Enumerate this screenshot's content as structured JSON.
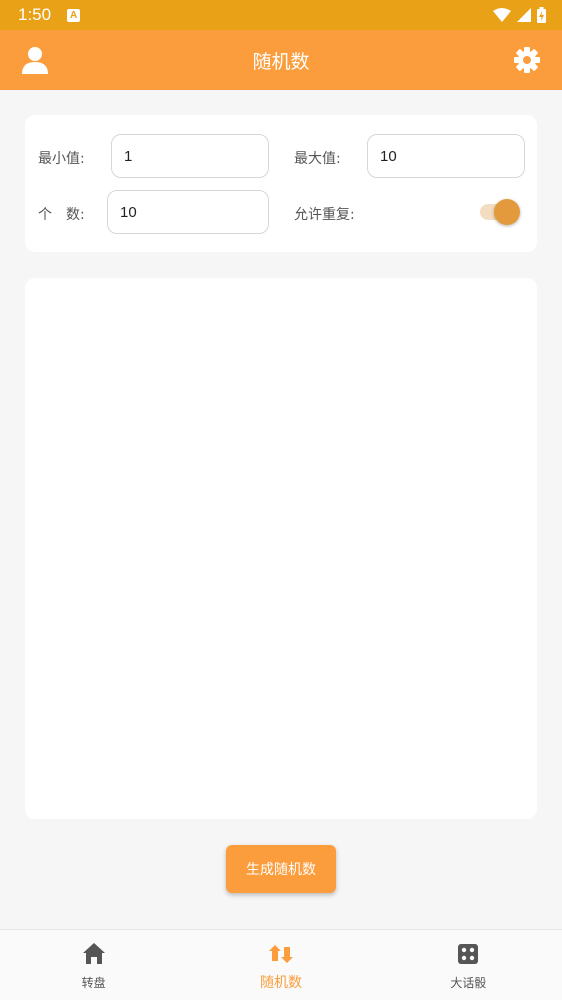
{
  "status_bar": {
    "time": "1:50",
    "notification_badge": "A"
  },
  "app_bar": {
    "title": "随机数",
    "left_icon": "user-icon",
    "right_icon": "gear-icon"
  },
  "settings": {
    "min_label": "最小值:",
    "min_value": "1",
    "max_label": "最大值:",
    "max_value": "10",
    "count_label": "个　数:",
    "count_value": "10",
    "repeat_label": "允许重复:",
    "repeat_enabled": true
  },
  "output": {
    "results": []
  },
  "generate_button": {
    "label": "生成随机数"
  },
  "bottom_nav": {
    "items": [
      {
        "label": "转盘",
        "icon": "home-icon",
        "active": false
      },
      {
        "label": "随机数",
        "icon": "swap-arrows-icon",
        "active": true
      },
      {
        "label": "大话骰",
        "icon": "dice-icon",
        "active": false
      }
    ]
  },
  "colors": {
    "status_bar": "#e9a218",
    "accent": "#fb9d3c",
    "toggle_thumb": "#e29a3c",
    "toggle_track": "#f4dcc0",
    "nav_inactive": "#555555"
  }
}
